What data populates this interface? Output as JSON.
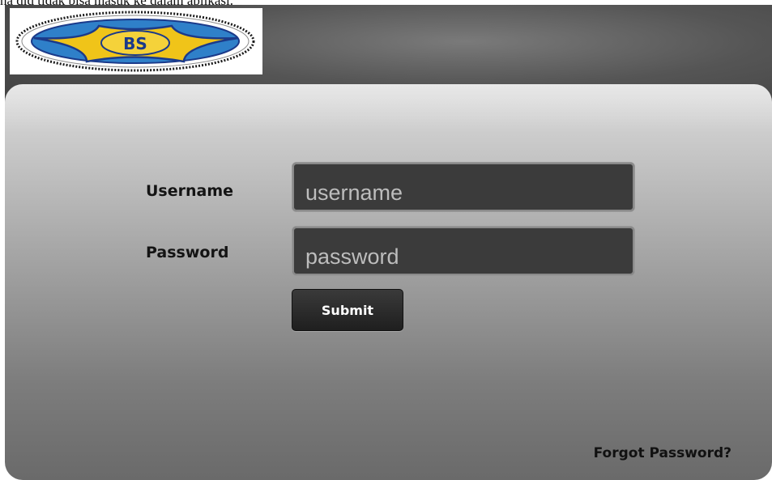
{
  "document": {
    "caption_fragment": "na did tidak bisa masuk ke dalam aplikasi."
  },
  "header": {
    "logo": {
      "text": "BS",
      "icon": "star-badge-logo",
      "colors": {
        "star": "#f0c419",
        "star_outline": "#1b3a8a",
        "oval": "#2f80c9",
        "ring": "#1a1a1a"
      }
    }
  },
  "login_form": {
    "username_label": "Username",
    "username_placeholder": "username",
    "username_value": "",
    "password_label": "Password",
    "password_placeholder": "password",
    "password_value": "",
    "submit_label": "Submit",
    "forgot_link": "Forgot Password?"
  },
  "theme": {
    "header_bg": "#555555",
    "panel_top": "#dcdcdc",
    "panel_bottom": "#6a6a6a",
    "field_bg": "#3b3b3b",
    "button_bg": "#1f1f1f"
  }
}
